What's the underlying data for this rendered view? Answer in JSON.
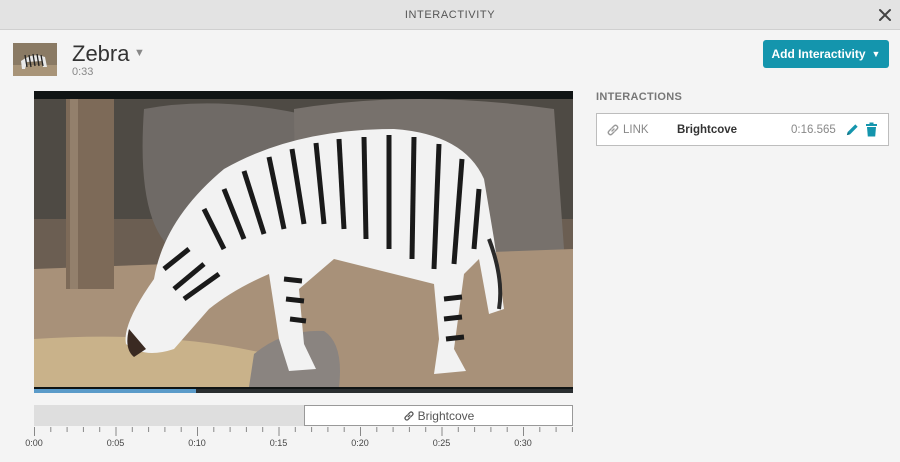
{
  "window": {
    "title": "INTERACTIVITY"
  },
  "video": {
    "name": "Zebra",
    "duration": "0:33"
  },
  "toolbar": {
    "add_label": "Add Interactivity",
    "add_caret": "▼"
  },
  "player": {
    "progress": 0.3
  },
  "timeline": {
    "link_label": "Brightcove",
    "ticks": [
      "0:00",
      "0:05",
      "0:10",
      "0:15",
      "0:20",
      "0:25",
      "0:30"
    ]
  },
  "interactions": {
    "header": "INTERACTIONS",
    "items": [
      {
        "type": "LINK",
        "target": "Brightcove",
        "time": "0:16.565"
      }
    ]
  },
  "colors": {
    "accent": "#1495ad",
    "titlebar": "#e3e3e3",
    "background": "#f4f4f4"
  },
  "icons": [
    "close-icon",
    "chevron-down-icon",
    "link-icon",
    "pencil-icon",
    "trash-icon"
  ]
}
